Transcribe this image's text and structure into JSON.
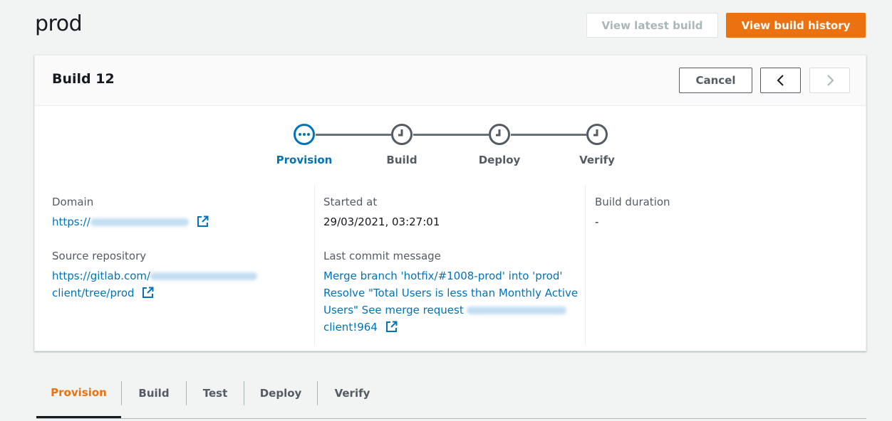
{
  "page": {
    "title": "prod"
  },
  "header_actions": {
    "view_latest_build": "View latest build",
    "view_build_history": "View build history"
  },
  "build": {
    "title": "Build 12",
    "cancel_label": "Cancel",
    "steps": [
      {
        "label": "Provision",
        "state": "in-progress"
      },
      {
        "label": "Build",
        "state": "pending"
      },
      {
        "label": "Deploy",
        "state": "pending"
      },
      {
        "label": "Verify",
        "state": "pending"
      }
    ],
    "domain": {
      "label": "Domain",
      "prefix": "https://"
    },
    "source_repository": {
      "label": "Source repository",
      "line1_prefix": "https://gitlab.com/",
      "line2": "client/tree/prod"
    },
    "started_at": {
      "label": "Started at",
      "value": "29/03/2021, 03:27:01"
    },
    "last_commit_message": {
      "label": "Last commit message",
      "line1": "Merge branch 'hotfix/#1008-prod' into 'prod'",
      "line2": "Resolve \"Total Users is less than Monthly Active",
      "line3_prefix": "Users\" See merge request",
      "line4": "client!964"
    },
    "build_duration": {
      "label": "Build duration",
      "value": "-"
    }
  },
  "tabs": [
    {
      "label": "Provision",
      "active": true
    },
    {
      "label": "Build"
    },
    {
      "label": "Test"
    },
    {
      "label": "Deploy"
    },
    {
      "label": "Verify"
    }
  ],
  "colors": {
    "accent": "#ec7211",
    "link": "#0073bb",
    "active_step": "#0073bb",
    "pending_step": "#545b64"
  }
}
